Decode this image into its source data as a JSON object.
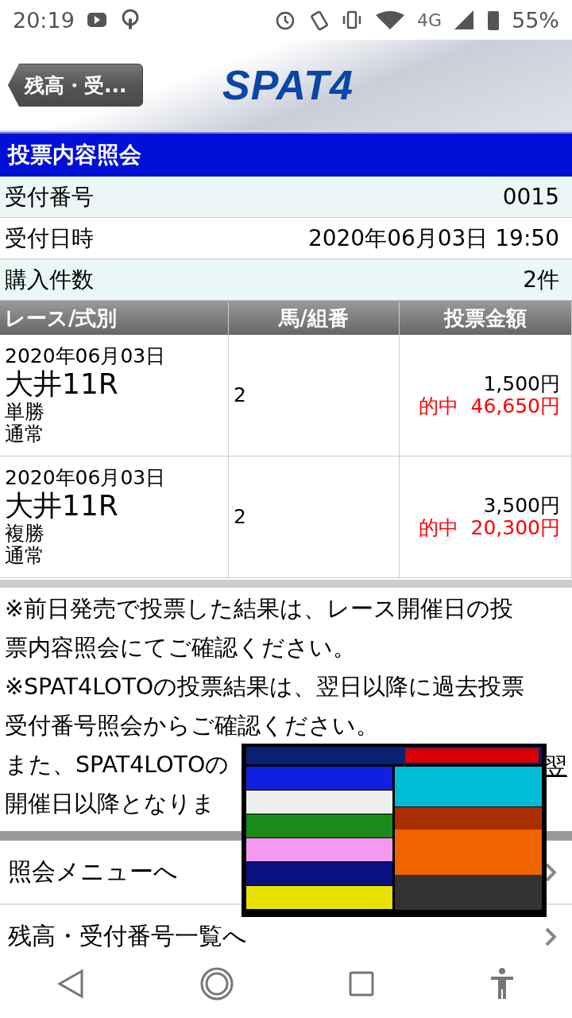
{
  "status_bar": {
    "time": "20:19",
    "network": "4G",
    "battery": "55%"
  },
  "header": {
    "back_button": "残高・受...",
    "logo": "SPAT4"
  },
  "title": "投票内容照会",
  "info": [
    {
      "label": "受付番号",
      "value": "0015"
    },
    {
      "label": "受付日時",
      "value": "2020年06月03日 19:50"
    },
    {
      "label": "購入件数",
      "value": "2件"
    }
  ],
  "table": {
    "columns": [
      "レース/式別",
      "馬/組番",
      "投票金額"
    ],
    "rows": [
      {
        "date": "2020年06月03日",
        "race": "大井11R",
        "bet_type": "単勝",
        "method": "通常",
        "horse": "2",
        "amount": "1,500円",
        "result_label": "的中",
        "payout": "46,650円"
      },
      {
        "date": "2020年06月03日",
        "race": "大井11R",
        "bet_type": "複勝",
        "method": "通常",
        "horse": "2",
        "amount": "3,500円",
        "result_label": "的中",
        "payout": "20,300円"
      }
    ]
  },
  "notes": [
    {
      "lines": [
        "※前日発売で投票した結果は、レース開催日の投",
        "票内容照会にてご確認ください。"
      ]
    },
    {
      "lines": [
        "※SPAT4LOTOの投票結果は、翌日以降に過去投票",
        "受付番号照会からご確認ください。"
      ]
    },
    {
      "lines": [
        "また、SPAT4LOTOの",
        "開催日以降となりま"
      ],
      "trailing": "翌"
    }
  ],
  "menu": [
    "照会メニューへ",
    "残高・受付番号一覧へ"
  ],
  "overlay": {
    "kind": "picture"
  }
}
